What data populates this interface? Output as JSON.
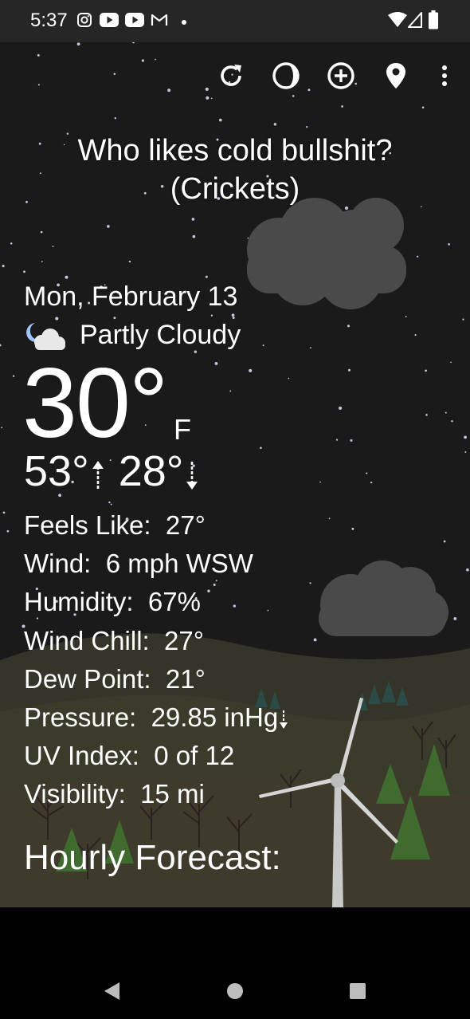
{
  "status_bar": {
    "time": "5:37",
    "left_icons": [
      "instagram-icon",
      "youtube-icon",
      "youtube-icon",
      "gmail-icon",
      "dot-icon"
    ],
    "right_icons": [
      "wifi-icon",
      "cell-signal-icon",
      "battery-icon"
    ]
  },
  "toolbar": {
    "buttons": [
      "refresh-icon",
      "moon-phase-icon",
      "add-location-icon",
      "location-pin-icon",
      "more-vert-icon"
    ]
  },
  "headline": {
    "line1": "Who likes cold bullshit?",
    "line2": "(Crickets)"
  },
  "weather": {
    "date": "Mon, February 13",
    "condition_icon": "partly-cloudy-night-icon",
    "condition": "Partly Cloudy",
    "temperature": "30°",
    "unit": "F",
    "high": "53°",
    "low": "28°",
    "details": [
      {
        "label": "Feels Like:",
        "value": "27°"
      },
      {
        "label": "Wind:",
        "value": "6 mph WSW"
      },
      {
        "label": "Humidity:",
        "value": "67%"
      },
      {
        "label": "Wind Chill:",
        "value": "27°"
      },
      {
        "label": "Dew Point:",
        "value": "21°"
      },
      {
        "label": "Pressure:",
        "value": "29.85 inHg"
      },
      {
        "label": "UV Index:",
        "value": "0 of 12"
      },
      {
        "label": "Visibility:",
        "value": "15 mi"
      }
    ],
    "hourly_title": "Hourly Forecast:"
  },
  "nav_bar": {
    "buttons": [
      "back-icon",
      "home-icon",
      "recents-icon"
    ]
  },
  "colors": {
    "sky": "#1a1a1b",
    "status_bar": "#262626",
    "text": "#ffffff",
    "cloud": "#4a4a4a",
    "hills": "#3b3b2e"
  }
}
